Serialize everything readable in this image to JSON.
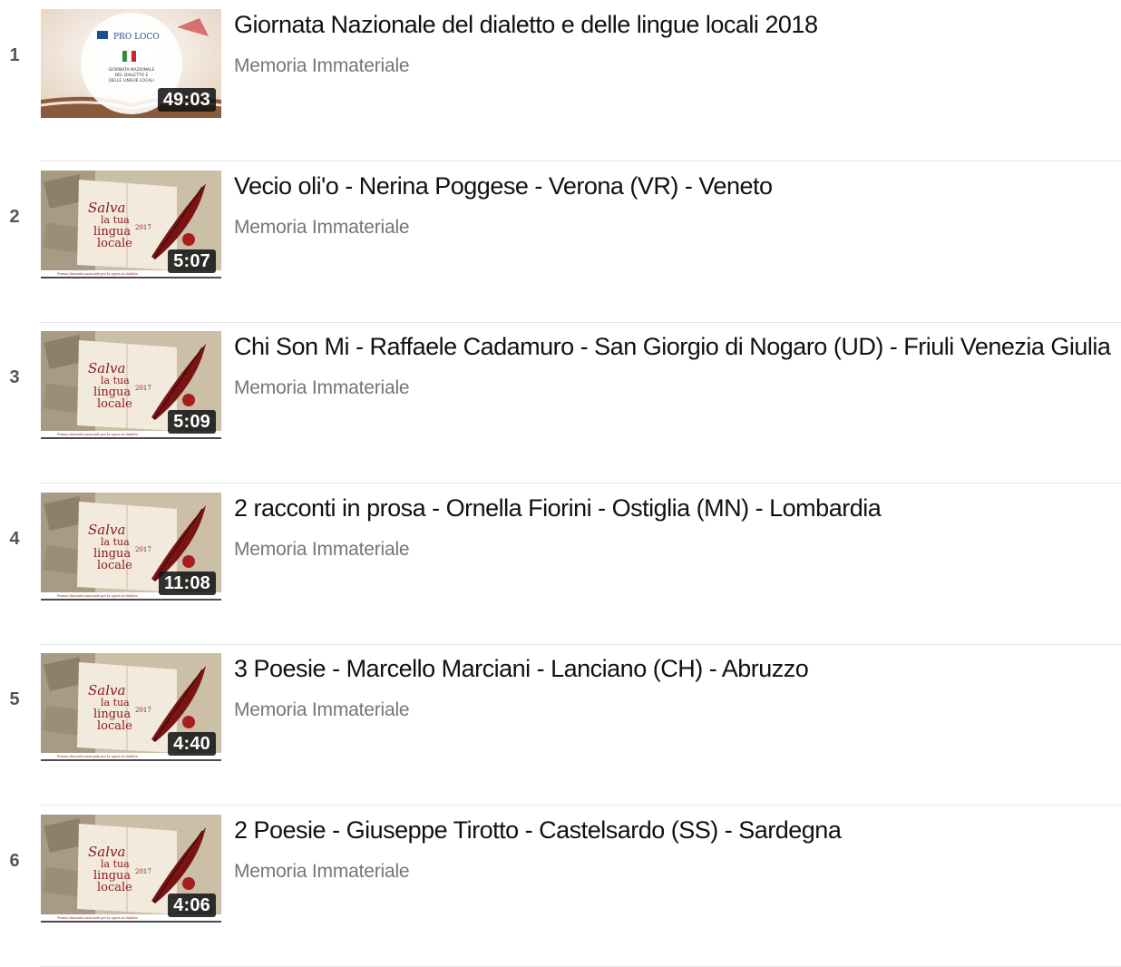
{
  "playlist": {
    "items": [
      {
        "index": "1",
        "title": "Giornata Nazionale del dialetto e delle lingue locali 2018",
        "channel": "Memoria Immateriale",
        "duration": "49:03",
        "thumbnail": "pro-loco-giornata-nazionale",
        "thumb_text": [
          "PRO LOCO",
          "GIORNATA NAZIONALE",
          "DEL DIALETTO E",
          "DELLE LINGUE LOCALI"
        ]
      },
      {
        "index": "2",
        "title": "Vecio oli'o - Nerina Poggese - Verona (VR) - Veneto",
        "channel": "Memoria Immateriale",
        "duration": "5:07",
        "thumbnail": "salva-la-tua-lingua-locale",
        "thumb_text": [
          "Salva",
          "la tua",
          "lingua",
          "locale",
          "2017"
        ]
      },
      {
        "index": "3",
        "title": "Chi Son Mi - Raffaele Cadamuro - San Giorgio di Nogaro (UD) - Friuli Venezia Giulia",
        "channel": "Memoria Immateriale",
        "duration": "5:09",
        "thumbnail": "salva-la-tua-lingua-locale",
        "thumb_text": [
          "Salva",
          "la tua",
          "lingua",
          "locale",
          "2017"
        ]
      },
      {
        "index": "4",
        "title": "2 racconti in prosa - Ornella Fiorini - Ostiglia (MN) - Lombardia",
        "channel": "Memoria Immateriale",
        "duration": "11:08",
        "thumbnail": "salva-la-tua-lingua-locale",
        "thumb_text": [
          "Salva",
          "la tua",
          "lingua",
          "locale",
          "2017"
        ]
      },
      {
        "index": "5",
        "title": "3 Poesie - Marcello Marciani - Lanciano (CH) - Abruzzo",
        "channel": "Memoria Immateriale",
        "duration": "4:40",
        "thumbnail": "salva-la-tua-lingua-locale",
        "thumb_text": [
          "Salva",
          "la tua",
          "lingua",
          "locale",
          "2017"
        ]
      },
      {
        "index": "6",
        "title": "2 Poesie - Giuseppe Tirotto - Castelsardo (SS) - Sardegna",
        "channel": "Memoria Immateriale",
        "duration": "4:06",
        "thumbnail": "salva-la-tua-lingua-locale",
        "thumb_text": [
          "Salva",
          "la tua",
          "lingua",
          "locale",
          "2017"
        ]
      }
    ]
  },
  "colors": {
    "title": "#111111",
    "channel": "#767676",
    "index": "#555555",
    "divider": "#e6e6e6",
    "duration_badge": "#111111",
    "accent_red": "#8b1a1a"
  }
}
